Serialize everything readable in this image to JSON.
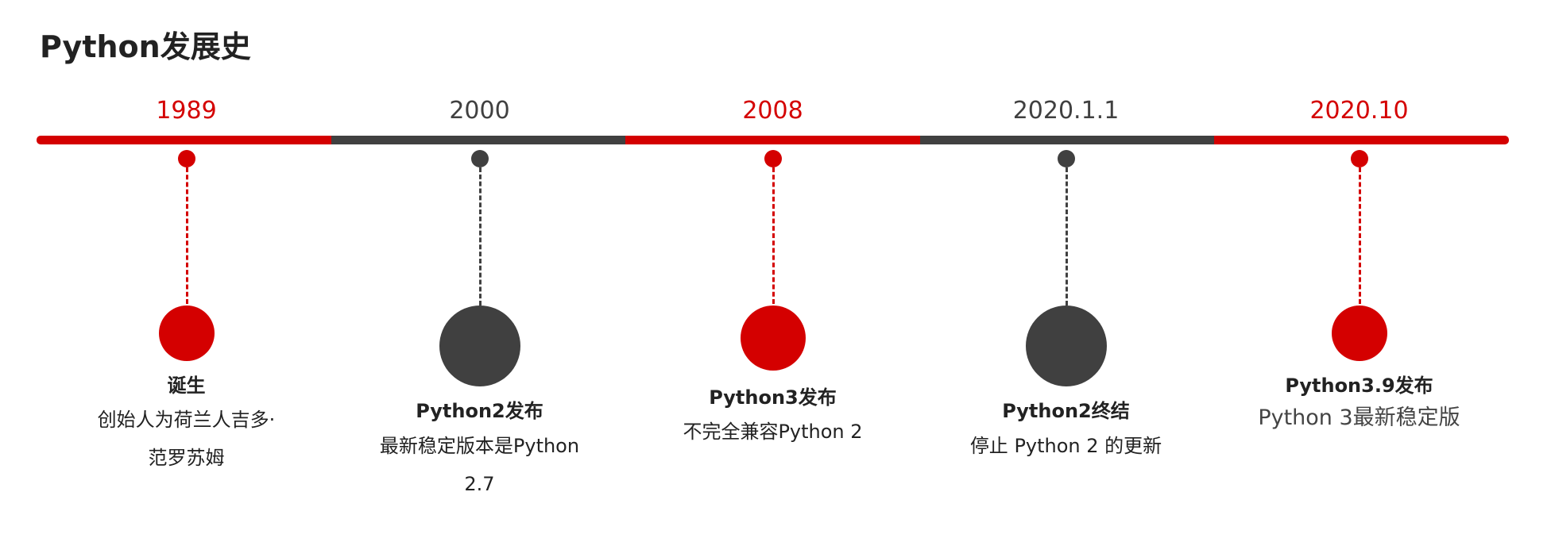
{
  "title": "Python发展史",
  "colors": {
    "accent_red": "#d40000",
    "dark_gray": "#404040",
    "text": "#222222"
  },
  "events": [
    {
      "year": "1989",
      "heading": "诞生",
      "description": "创始人为荷兰人吉多·范罗苏姆",
      "color": "accent_red"
    },
    {
      "year": "2000",
      "heading": "Python2发布",
      "description": "最新稳定版本是Python 2.7",
      "color": "dark_gray"
    },
    {
      "year": "2008",
      "heading": "Python3发布",
      "description": "不完全兼容Python 2",
      "color": "accent_red"
    },
    {
      "year": "2020.1.1",
      "heading": "Python2终结",
      "description": "停止 Python 2 的更新",
      "color": "dark_gray"
    },
    {
      "year": "2020.10",
      "heading": "Python3.9发布",
      "description": "Python 3最新稳定版",
      "color": "accent_red"
    }
  ]
}
